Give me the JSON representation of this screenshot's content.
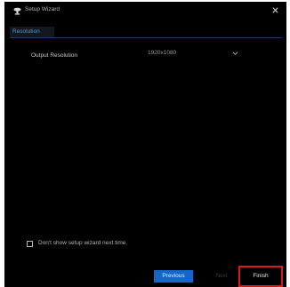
{
  "window": {
    "title": "Setup Wizard",
    "icon": "wizard-logo-icon",
    "close_icon": "close-icon"
  },
  "tabs": [
    {
      "label": "Resolution",
      "active": true
    }
  ],
  "settings": {
    "output_resolution_label": "Output Resolution",
    "output_resolution_value": "1920x1080",
    "dropdown_icon": "chevron-down-icon"
  },
  "footer": {
    "checkbox_label": "Don't show setup wizard next time.",
    "checkbox_checked": false,
    "previous_label": "Previous",
    "next_label": "Next",
    "finish_label": "Finish",
    "next_enabled": false,
    "finish_highlighted": true
  },
  "colors": {
    "background": "#000000",
    "accent": "#1467c6",
    "tab_text": "#4e96d3",
    "highlight": "#e01a1a"
  }
}
